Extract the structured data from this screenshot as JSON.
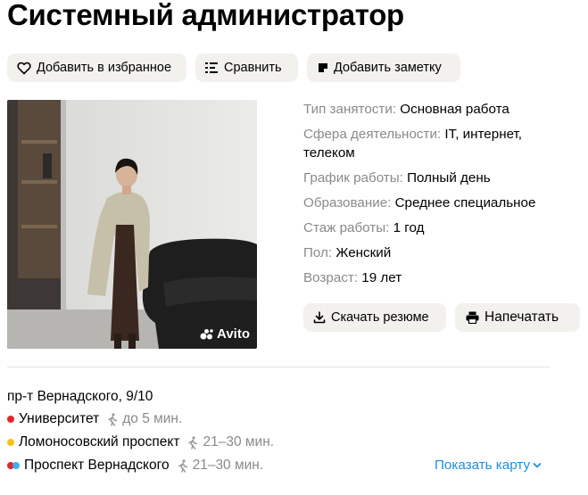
{
  "title": "Системный администратор",
  "actions": {
    "favorite": "Добавить в избранное",
    "compare": "Сравнить",
    "note": "Добавить заметку"
  },
  "photo": {
    "watermark": "Avito"
  },
  "params": [
    {
      "key": "Тип занятости:",
      "value": "Основная работа"
    },
    {
      "key": "Сфера деятельности:",
      "value": "IT, интернет, телеком"
    },
    {
      "key": "График работы:",
      "value": "Полный день"
    },
    {
      "key": "Образование:",
      "value": "Среднее специальное"
    },
    {
      "key": "Стаж работы:",
      "value": "1 год"
    },
    {
      "key": "Пол:",
      "value": "Женский"
    },
    {
      "key": "Возраст:",
      "value": "19 лет"
    }
  ],
  "resume_actions": {
    "download": "Скачать резюме",
    "print": "Напечатать"
  },
  "location": {
    "address": "пр-т Вернадского, 9/10",
    "metro": [
      {
        "name": "Университет",
        "time": "до 5 мин.",
        "colors": [
          "#e4252b"
        ]
      },
      {
        "name": "Ломоносовский проспект",
        "time": "21–30 мин.",
        "colors": [
          "#f5c016"
        ]
      },
      {
        "name": "Проспект Вернадского",
        "time": "21–30 мин.",
        "colors": [
          "#e4252b",
          "#3bb1e6"
        ]
      }
    ],
    "show_map": "Показать карту"
  },
  "colors": {
    "button_bg": "#f2f1ee",
    "link": "#1e8fe0",
    "muted": "#8a8a8a"
  }
}
